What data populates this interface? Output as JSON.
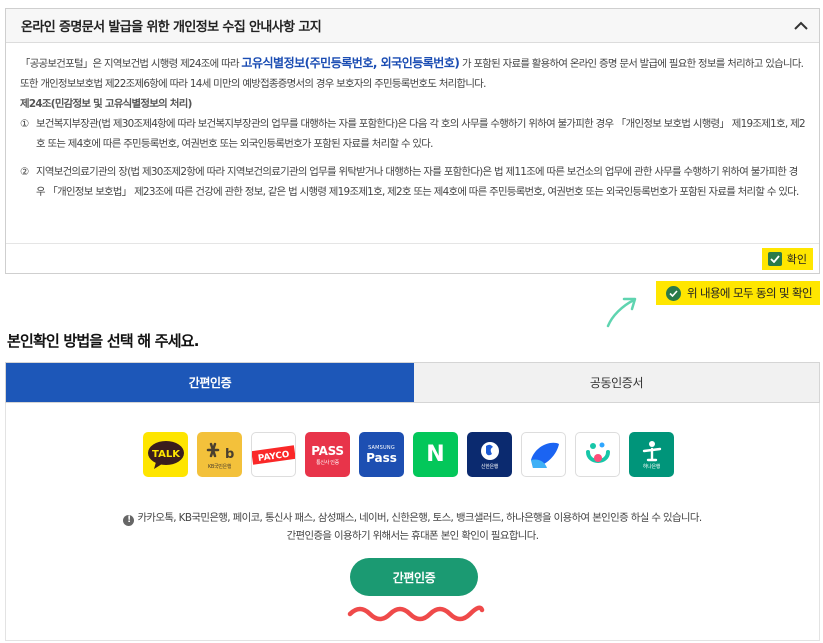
{
  "notice": {
    "title": "온라인 증명문서 발급을 위한 개인정보 수집 안내사항 고지",
    "para1_pre": "「공공보건포털」은 지역보건법 시행령 제24조에 따라 ",
    "para1_hl": "고유식별정보(주민등록번호, 외국인등록번호)",
    "para1_post": " 가 포함된 자료를 활용하여 온라인 증명 문서 발급에 필요한 정보를 처리하고 있습니다. 또한 개인정보보호법 제22조제6항에 따라 14세 미만의 예방접종증명서의 경우 보호자의 주민등록번호도 처리합니다.",
    "section": "제24조(민감정보 및 고유식별정보의 처리)",
    "items": [
      {
        "num": "①",
        "text": "보건복지부장관(법 제30조제4항에 따라 보건복지부장관의 업무를 대행하는 자를 포함한다)은 다음 각 호의 사무를 수행하기 위하여 불가피한 경우 「개인정보 보호법 시행령」 제19조제1호, 제2호 또는 제4호에 따른 주민등록번호, 여권번호 또는 외국인등록번호가 포함된 자료를 처리할 수 있다."
      },
      {
        "num": "②",
        "text": "지역보건의료기관의 장(법 제30조제2항에 따라 지역보건의료기관의 업무를 위탁받거나 대행하는 자를 포함한다)은 법 제11조에 따른 보건소의 업무에 관한 사무를 수행하기 위하여 불가피한 경우 「개인정보 보호법」 제23조에 따른 건강에 관한 정보, 같은 법 시행령 제19조제1호, 제2호 또는 제4호에 따른 주민등록번호, 여권번호 또는 외국인등록번호가 포함된 자료를 처리할 수 있다."
      }
    ],
    "confirm_label": "확인"
  },
  "agree_all_label": "위 내용에 모두 동의 및 확인",
  "method_title": "본인확인 방법을 선택 해 주세요.",
  "tabs": [
    {
      "label": "간편인증",
      "active": true
    },
    {
      "label": "공동인증서",
      "active": false
    }
  ],
  "providers": {
    "kakao": "TALK",
    "kb_sub": "KB국민은행",
    "payco": "PAYCO",
    "pass": "PASS",
    "pass_sub": "통신사 인증",
    "samsung_top": "SAMSUNG",
    "samsung": "Pass",
    "naver": "N",
    "shinhan_sub": "신한은행",
    "hana_sub": "하나은행"
  },
  "info_line1": "카카오톡, KB국민은행, 페이코, 통신사 패스, 삼성패스, 네이버, 신한은행, 토스, 뱅크샐러드, 하나은행을 이용하여 본인인증 하실 수 있습니다.",
  "info_line2": "간편인증을 이용하기 위해서는 휴대폰 본인 확인이 필요합니다.",
  "submit_label": "간편인증",
  "colors": {
    "tab_active": "#1d57b8",
    "submit": "#1b9a72",
    "highlight": "#ffe600",
    "check": "#2a7a4a"
  }
}
